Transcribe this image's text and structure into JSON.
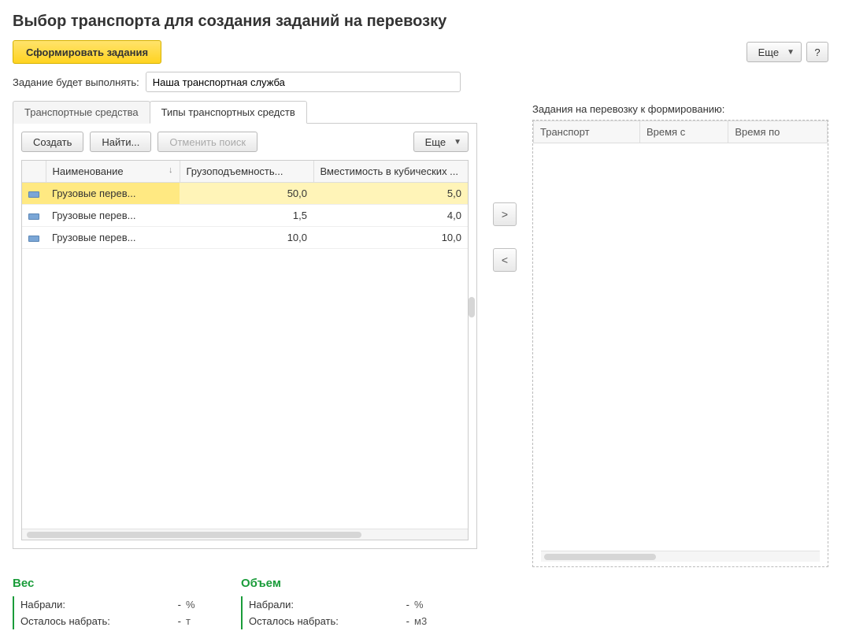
{
  "title": "Выбор транспорта для создания заданий на перевозку",
  "toolbar": {
    "form_tasks": "Сформировать задания",
    "more": "Еще",
    "help": "?"
  },
  "assignee": {
    "label": "Задание будет выполнять:",
    "value": "Наша транспортная служба"
  },
  "tabs": {
    "vehicles": "Транспортные средства",
    "vehicle_types": "Типы транспортных средств"
  },
  "panel_toolbar": {
    "create": "Создать",
    "find": "Найти...",
    "cancel_search": "Отменить поиск",
    "more": "Еще"
  },
  "grid": {
    "headers": {
      "name": "Наименование",
      "capacity": "Грузоподъемность...",
      "volume": "Вместимость в кубических ..."
    },
    "rows": [
      {
        "name": "Грузовые перев...",
        "capacity": "50,0",
        "volume": "5,0"
      },
      {
        "name": "Грузовые перев...",
        "capacity": "1,5",
        "volume": "4,0"
      },
      {
        "name": "Грузовые перев...",
        "capacity": "10,0",
        "volume": "10,0"
      }
    ]
  },
  "move": {
    "right": ">",
    "left": "<"
  },
  "right": {
    "label": "Задания на перевозку к формированию:",
    "headers": {
      "transport": "Транспорт",
      "time_from": "Время с",
      "time_to": "Время по"
    }
  },
  "stats": {
    "weight": {
      "title": "Вес",
      "collected_label": "Набрали:",
      "collected_value": "-",
      "collected_unit": "%",
      "remaining_label": "Осталось набрать:",
      "remaining_value": "-",
      "remaining_unit": "т"
    },
    "volume": {
      "title": "Объем",
      "collected_label": "Набрали:",
      "collected_value": "-",
      "collected_unit": "%",
      "remaining_label": "Осталось набрать:",
      "remaining_value": "-",
      "remaining_unit": "м3"
    }
  }
}
